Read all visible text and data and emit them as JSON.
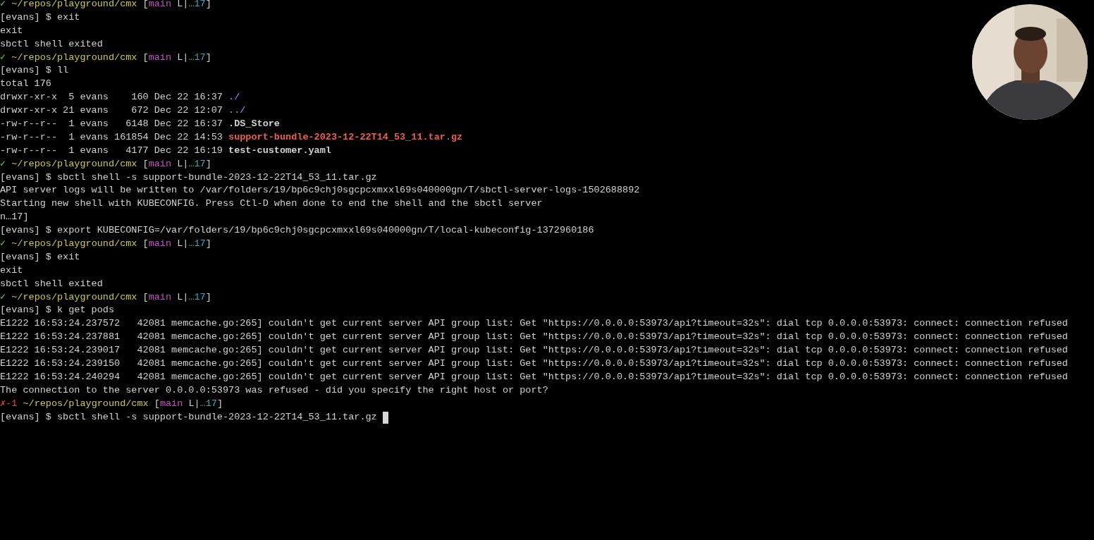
{
  "terminal": {
    "lines": [
      {
        "kind": "prompt",
        "error": false,
        "status": "✓",
        "path": "~/repos/playground/cmx",
        "open": "[",
        "branch": "main",
        "flags": "L|",
        "count": "…17",
        "close": "]"
      },
      {
        "kind": "text",
        "text": "[evans] $ exit"
      },
      {
        "kind": "text",
        "text": "exit"
      },
      {
        "kind": "text",
        "text": "sbctl shell exited"
      },
      {
        "kind": "prompt",
        "error": false,
        "status": "✓",
        "path": "~/repos/playground/cmx",
        "open": "[",
        "branch": "main",
        "flags": "L|",
        "count": "…17",
        "close": "]"
      },
      {
        "kind": "text",
        "text": "[evans] $ ll"
      },
      {
        "kind": "text",
        "text": "total 176"
      },
      {
        "kind": "listing",
        "text": "drwxr-xr-x  5 evans    160 Dec 22 16:37 ",
        "file": {
          "name": "./",
          "color": "#6f7fe0"
        }
      },
      {
        "kind": "listing",
        "text": "drwxr-xr-x 21 evans    672 Dec 22 12:07 ",
        "file": {
          "name": "../",
          "color": "#6f7fe0"
        }
      },
      {
        "kind": "listing",
        "text": "-rw-r--r--  1 evans   6148 Dec 22 16:37 ",
        "file": {
          "name": ".DS_Store",
          "color": "#d2d2d2"
        }
      },
      {
        "kind": "listing",
        "text": "-rw-r--r--  1 evans 161854 Dec 22 14:53 ",
        "file": {
          "name": "support-bundle-2023-12-22T14_53_11.tar.gz",
          "color": "#ec5f4f"
        }
      },
      {
        "kind": "listing",
        "text": "-rw-r--r--  1 evans   4177 Dec 22 16:19 ",
        "file": {
          "name": "test-customer.yaml",
          "color": "#d2d2d2"
        }
      },
      {
        "kind": "prompt",
        "error": false,
        "status": "✓",
        "path": "~/repos/playground/cmx",
        "open": "[",
        "branch": "main",
        "flags": "L|",
        "count": "…17",
        "close": "]"
      },
      {
        "kind": "text",
        "text": "[evans] $ sbctl shell -s support-bundle-2023-12-22T14_53_11.tar.gz"
      },
      {
        "kind": "text",
        "text": "API server logs will be written to /var/folders/19/bp6c9chj0sgcpcxmxxl69s040000gn/T/sbctl-server-logs-1502688892"
      },
      {
        "kind": "text",
        "text": "Starting new shell with KUBECONFIG. Press Ctl-D when done to end the shell and the sbctl server"
      },
      {
        "kind": "text",
        "text": "n…17]"
      },
      {
        "kind": "text",
        "text": "[evans] $ export KUBECONFIG=/var/folders/19/bp6c9chj0sgcpcxmxxl69s040000gn/T/local-kubeconfig-1372960186"
      },
      {
        "kind": "prompt",
        "error": false,
        "status": "✓",
        "path": "~/repos/playground/cmx",
        "open": "[",
        "branch": "main",
        "flags": "L|",
        "count": "…17",
        "close": "]"
      },
      {
        "kind": "text",
        "text": "[evans] $ exit"
      },
      {
        "kind": "text",
        "text": "exit"
      },
      {
        "kind": "text",
        "text": "sbctl shell exited"
      },
      {
        "kind": "prompt",
        "error": false,
        "status": "✓",
        "path": "~/repos/playground/cmx",
        "open": "[",
        "branch": "main",
        "flags": "L|",
        "count": "…17",
        "close": "]"
      },
      {
        "kind": "text",
        "text": "[evans] $ k get pods"
      },
      {
        "kind": "text",
        "text": "E1222 16:53:24.237572   42081 memcache.go:265] couldn't get current server API group list: Get \"https://0.0.0.0:53973/api?timeout=32s\": dial tcp 0.0.0.0:53973: connect: connection refused"
      },
      {
        "kind": "text",
        "text": "E1222 16:53:24.237881   42081 memcache.go:265] couldn't get current server API group list: Get \"https://0.0.0.0:53973/api?timeout=32s\": dial tcp 0.0.0.0:53973: connect: connection refused"
      },
      {
        "kind": "text",
        "text": "E1222 16:53:24.239017   42081 memcache.go:265] couldn't get current server API group list: Get \"https://0.0.0.0:53973/api?timeout=32s\": dial tcp 0.0.0.0:53973: connect: connection refused"
      },
      {
        "kind": "text",
        "text": "E1222 16:53:24.239150   42081 memcache.go:265] couldn't get current server API group list: Get \"https://0.0.0.0:53973/api?timeout=32s\": dial tcp 0.0.0.0:53973: connect: connection refused"
      },
      {
        "kind": "text",
        "text": "E1222 16:53:24.240294   42081 memcache.go:265] couldn't get current server API group list: Get \"https://0.0.0.0:53973/api?timeout=32s\": dial tcp 0.0.0.0:53973: connect: connection refused"
      },
      {
        "kind": "text",
        "text": "The connection to the server 0.0.0.0:53973 was refused - did you specify the right host or port?"
      },
      {
        "kind": "prompt",
        "error": true,
        "status": "✗-1",
        "path": "~/repos/playground/cmx",
        "open": "[",
        "branch": "main",
        "flags": "L|",
        "count": "…17",
        "close": "]"
      },
      {
        "kind": "input",
        "text": "[evans] $ sbctl shell -s support-bundle-2023-12-22T14_53_11.tar.gz"
      }
    ]
  }
}
